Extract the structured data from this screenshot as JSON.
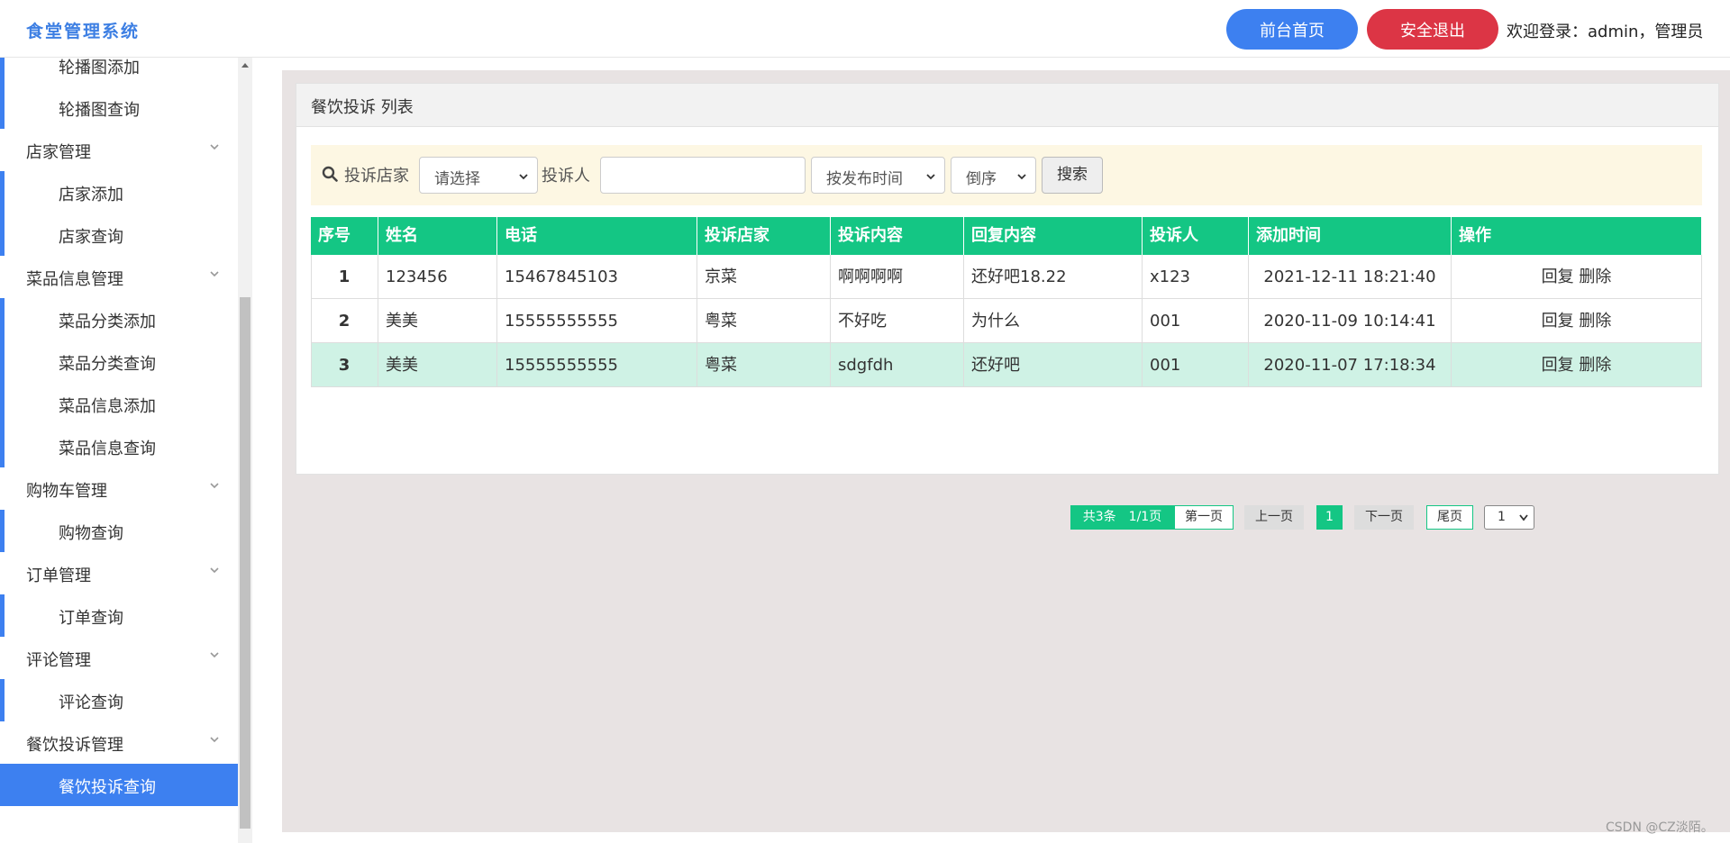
{
  "header": {
    "title": "食堂管理系统",
    "home_button": "前台首页",
    "logout_button": "安全退出",
    "welcome": "欢迎登录：admin，管理员"
  },
  "sidebar": {
    "items": [
      {
        "type": "sub",
        "label": "轮播图添加"
      },
      {
        "type": "sub",
        "label": "轮播图查询"
      },
      {
        "type": "group",
        "label": "店家管理"
      },
      {
        "type": "sub",
        "label": "店家添加"
      },
      {
        "type": "sub",
        "label": "店家查询"
      },
      {
        "type": "group",
        "label": "菜品信息管理"
      },
      {
        "type": "sub",
        "label": "菜品分类添加"
      },
      {
        "type": "sub",
        "label": "菜品分类查询"
      },
      {
        "type": "sub",
        "label": "菜品信息添加"
      },
      {
        "type": "sub",
        "label": "菜品信息查询"
      },
      {
        "type": "group",
        "label": "购物车管理"
      },
      {
        "type": "sub",
        "label": "购物查询"
      },
      {
        "type": "group",
        "label": "订单管理"
      },
      {
        "type": "sub",
        "label": "订单查询"
      },
      {
        "type": "group",
        "label": "评论管理"
      },
      {
        "type": "sub",
        "label": "评论查询"
      },
      {
        "type": "group",
        "label": "餐饮投诉管理"
      },
      {
        "type": "sub",
        "label": "餐饮投诉查询",
        "active": true
      }
    ]
  },
  "panel": {
    "title": "餐饮投诉 列表"
  },
  "search": {
    "store_label": "投诉店家",
    "store_select": "请选择",
    "complainant_label": "投诉人",
    "complainant_value": "",
    "sort_field": "按发布时间",
    "sort_order": "倒序",
    "search_button": "搜索"
  },
  "table": {
    "columns": [
      "序号",
      "姓名",
      "电话",
      "投诉店家",
      "投诉内容",
      "回复内容",
      "投诉人",
      "添加时间",
      "操作"
    ],
    "rows": [
      {
        "no": "1",
        "name": "123456",
        "phone": "15467845103",
        "store": "京菜",
        "content": "啊啊啊啊",
        "reply": "还好吧18.22",
        "complainant": "x123",
        "time": "2021-12-11 18:21:40",
        "reply_action": "回复",
        "delete_action": "删除"
      },
      {
        "no": "2",
        "name": "美美",
        "phone": "15555555555",
        "store": "粤菜",
        "content": "不好吃",
        "reply": "为什么",
        "complainant": "001",
        "time": "2020-11-09 10:14:41",
        "reply_action": "回复",
        "delete_action": "删除"
      },
      {
        "no": "3",
        "name": "美美",
        "phone": "15555555555",
        "store": "粤菜",
        "content": "sdgfdh",
        "reply": "还好吧",
        "complainant": "001",
        "time": "2020-11-07 17:18:34",
        "reply_action": "回复",
        "delete_action": "删除"
      }
    ]
  },
  "pagination": {
    "info": "共3条　1/1页",
    "first": "第一页",
    "prev": "上一页",
    "current": "1",
    "next": "下一页",
    "last": "尾页",
    "page_select": "1"
  },
  "watermark": "CSDN @CZ淡陌。",
  "colors": {
    "primary_blue": "#3d80f0",
    "danger_red": "#dc3545",
    "table_green": "#14c684",
    "highlight_row": "#cff2e5"
  }
}
